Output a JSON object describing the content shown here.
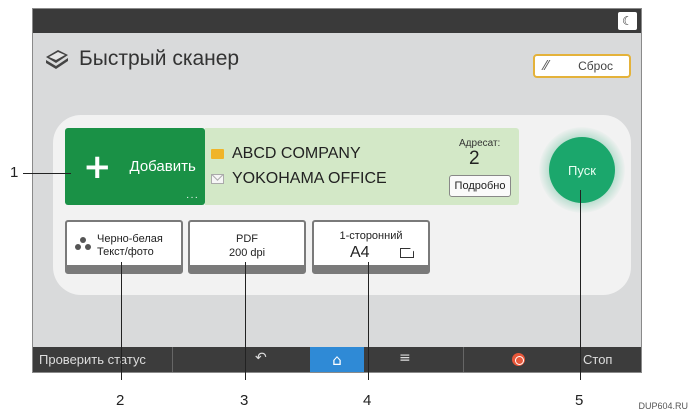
{
  "header": {
    "title": "Быстрый сканер",
    "reset_label": "Сброс",
    "night_icon": "moon-icon"
  },
  "add_button": {
    "label": "Добавить"
  },
  "destination": {
    "name": "ABCD COMPANY",
    "email": "YOKOHAMA OFFICE",
    "count_label": "Адресат:",
    "count": "2",
    "details_label": "Подробно"
  },
  "start_button": {
    "label": "Пуск"
  },
  "options": {
    "color_line1": "Черно-белая",
    "color_line2": "Текст/фото",
    "format_line1": "PDF",
    "format_line2": "200 dpi",
    "sides": "1-сторонний",
    "paper_size": "A4"
  },
  "bottom_bar": {
    "status_label": "Проверить статус",
    "stop_label": "Стоп"
  },
  "callouts": [
    "1",
    "2",
    "3",
    "4",
    "5"
  ],
  "footnote": "DUP604.RU"
}
